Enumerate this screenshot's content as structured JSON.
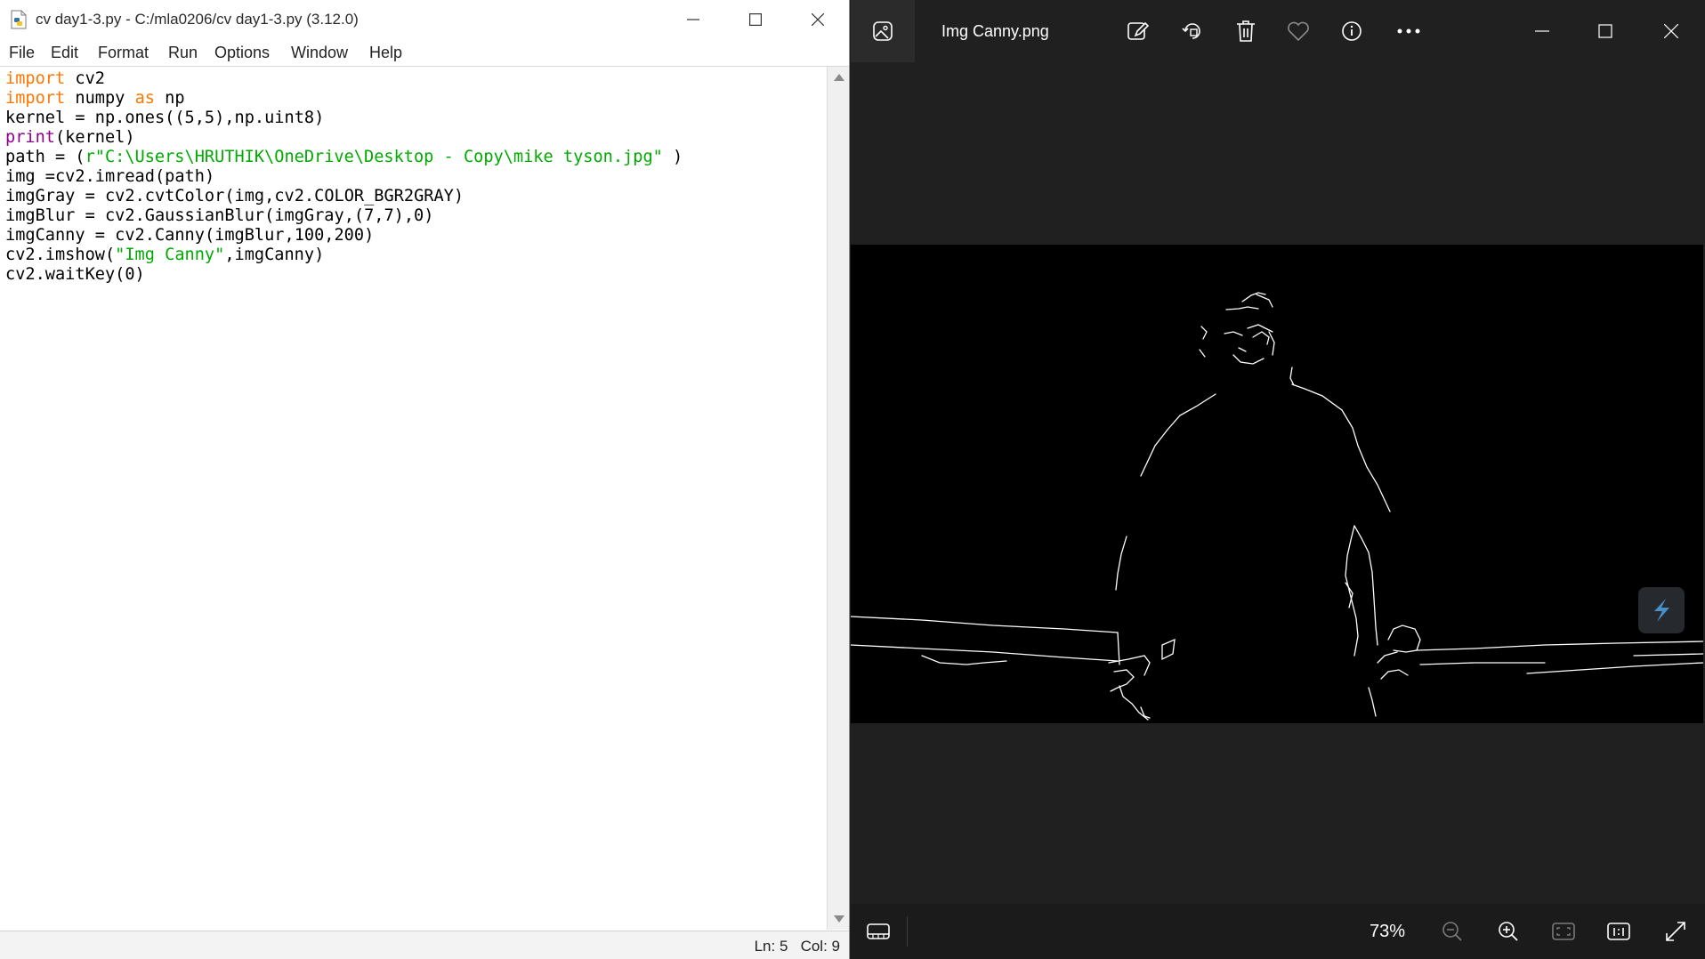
{
  "idle": {
    "title": "cv day1-3.py - C:/mla0206/cv day1-3.py (3.12.0)",
    "menu": [
      "File",
      "Edit",
      "Format",
      "Run",
      "Options",
      "Window",
      "Help"
    ],
    "code_lines": [
      "import cv2",
      "import numpy as np",
      "kernel = np.ones((5,5),np.uint8)",
      "print(kernel)",
      "path = (r\"C:\\Users\\HRUTHIK\\OneDrive\\Desktop - Copy\\mike tyson.jpg\" )",
      "img =cv2.imread(path)",
      "imgGray = cv2.cvtColor(img,cv2.COLOR_BGR2GRAY)",
      "imgBlur = cv2.GaussianBlur(imgGray,(7,7),0)",
      "imgCanny = cv2.Canny(imgBlur,100,200)",
      "cv2.imshow(\"Img Canny\",imgCanny)",
      "cv2.waitKey(0)"
    ],
    "status": {
      "line": "Ln: 5",
      "col": "Col: 9"
    },
    "colors": {
      "keyword": "#ff7700",
      "builtin": "#900090",
      "string": "#00aa00"
    }
  },
  "photos": {
    "filename": "Img Canny.png",
    "toolbar_icons": [
      "gallery-icon",
      "edit-icon",
      "rotate-icon",
      "delete-icon",
      "favorite-icon",
      "info-icon",
      "more-icon"
    ],
    "window_icons": [
      "minimize-icon",
      "maximize-icon",
      "close-icon"
    ],
    "zoom": "73%",
    "bottom_icons": [
      "filmstrip-icon",
      "zoom-out-icon",
      "zoom-in-icon",
      "fit-to-window-icon",
      "actual-size-icon",
      "fullscreen-icon"
    ]
  }
}
